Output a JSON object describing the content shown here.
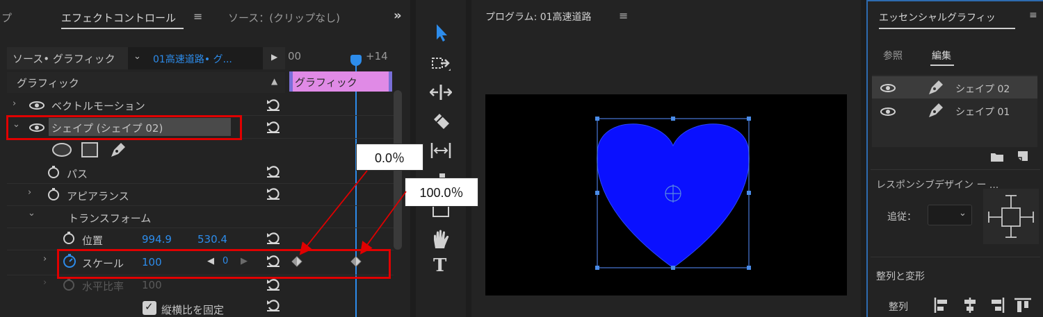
{
  "effect_panel": {
    "left_tab_fragment": "プ",
    "active_tab": "エフェクトコントロール",
    "source_tab": "ソース：(クリップなし)",
    "overflow": "»",
    "source_label": "ソース• グラフィック",
    "clip_label": "01高速道路• グ...",
    "timecode_start": "00",
    "timecode_end": "+14",
    "section_header": "グラフィック",
    "clip_bar_label": "グラフィック",
    "rows": {
      "vector_motion": "ベクトルモーション",
      "shape": "シェイプ (シェイプ 02)",
      "path": "パス",
      "appearance": "アピアランス",
      "transform": "トランスフォーム",
      "position": "位置",
      "position_x": "994.9",
      "position_y": "530.4",
      "scale": "スケール",
      "scale_value": "100",
      "keyframe_count": "0",
      "horiz_ratio": "水平比率",
      "horiz_value": "100",
      "lock_aspect": "縦横比を固定"
    }
  },
  "program_monitor": {
    "title": "プログラム: 01高速道路",
    "menu": "≡"
  },
  "essential_graphics": {
    "title": "エッセンシャルグラフィッ",
    "tabs": [
      "参照",
      "編集"
    ],
    "active_tab": "編集",
    "layers": [
      "シェイプ 02",
      "シェイプ 01"
    ],
    "responsive_label": "レスポンシブデザイン ー ...",
    "follow_label": "追従：",
    "align_header": "整列と変形",
    "align_label": "整列"
  },
  "callouts": {
    "left": "0.0％",
    "right": "100.0％"
  },
  "colors": {
    "highlight": "#e00000",
    "accent": "#2d8ceb",
    "heart": "#0a10ff",
    "clip_bar": "#e08ae6"
  }
}
